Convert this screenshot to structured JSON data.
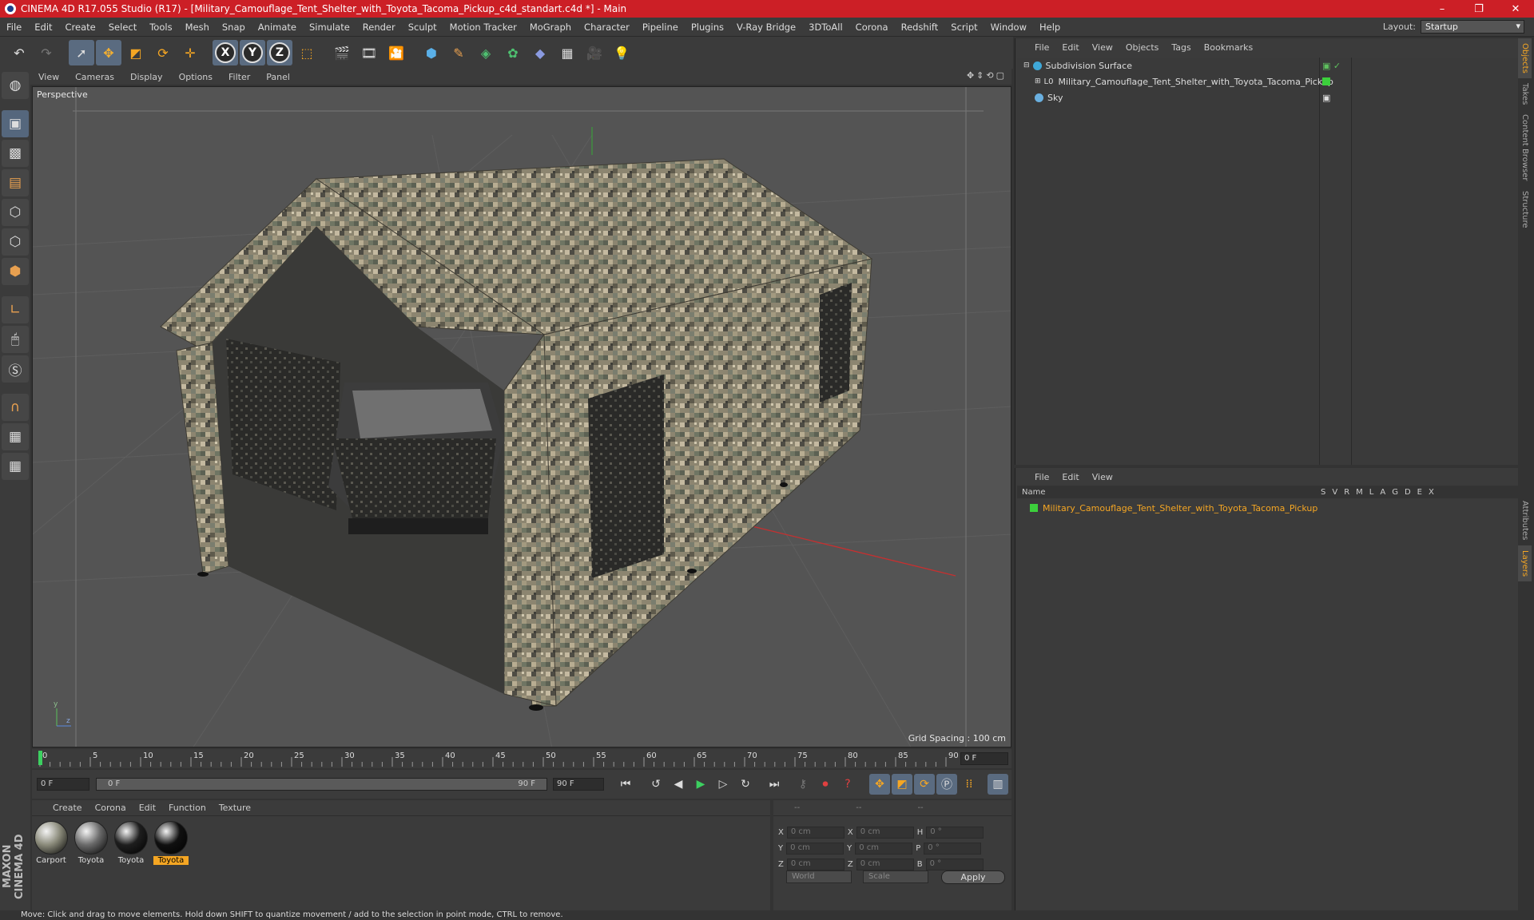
{
  "window": {
    "title": "CINEMA 4D R17.055 Studio (R17) - [Military_Camouflage_Tent_Shelter_with_Toyota_Tacoma_Pickup_c4d_standart.c4d *] - Main",
    "controls": [
      "–",
      "❐",
      "✕"
    ]
  },
  "menu": [
    "File",
    "Edit",
    "Create",
    "Select",
    "Tools",
    "Mesh",
    "Snap",
    "Animate",
    "Simulate",
    "Render",
    "Sculpt",
    "Motion Tracker",
    "MoGraph",
    "Character",
    "Pipeline",
    "Plugins",
    "V-Ray Bridge",
    "3DToAll",
    "Corona",
    "Redshift",
    "Script",
    "Window",
    "Help"
  ],
  "layout": {
    "label": "Layout:",
    "value": "Startup"
  },
  "toolbar": {
    "undo": "↶",
    "redo": "↷",
    "axis_x": "X",
    "axis_y": "Y",
    "axis_z": "Z"
  },
  "viewport": {
    "menu": [
      "View",
      "Cameras",
      "Display",
      "Options",
      "Filter",
      "Panel"
    ],
    "label": "Perspective",
    "grid_spacing": "Grid Spacing : 100 cm",
    "nav": "✥⇕⟲▢"
  },
  "timeline": {
    "ticks": [
      "0",
      "5",
      "10",
      "15",
      "20",
      "25",
      "30",
      "35",
      "40",
      "45",
      "50",
      "55",
      "60",
      "65",
      "70",
      "75",
      "80",
      "85",
      "90"
    ],
    "current": "0 F"
  },
  "playbar": {
    "start": "0 F",
    "slider_left": "0 F",
    "slider_right": "90 F",
    "end": "90 F"
  },
  "materials": {
    "menu": [
      "Create",
      "Corona",
      "Edit",
      "Function",
      "Texture"
    ],
    "items": [
      {
        "label": "Carport",
        "color": "#8a8a7a"
      },
      {
        "label": "Toyota",
        "color": "#6a6a6a"
      },
      {
        "label": "Toyota",
        "color": "#1e1e1e"
      },
      {
        "label": "Toyota",
        "color": "#101010",
        "selected": true
      }
    ]
  },
  "coords": {
    "headers": [
      "--",
      "--",
      "--"
    ],
    "rows": [
      {
        "a": "X",
        "av": "0 cm",
        "b": "X",
        "bv": "0 cm",
        "c": "H",
        "cv": "0 °"
      },
      {
        "a": "Y",
        "av": "0 cm",
        "b": "Y",
        "bv": "0 cm",
        "c": "P",
        "cv": "0 °"
      },
      {
        "a": "Z",
        "av": "0 cm",
        "b": "Z",
        "bv": "0 cm",
        "c": "B",
        "cv": "0 °"
      }
    ],
    "world": "World",
    "scale": "Scale",
    "apply": "Apply"
  },
  "objects": {
    "menu": [
      "File",
      "Edit",
      "View",
      "Objects",
      "Tags",
      "Bookmarks"
    ],
    "items": [
      {
        "name": "Subdivision Surface",
        "color": "#3fa8d8"
      },
      {
        "name": "Military_Camouflage_Tent_Shelter_with_Toyota_Tacoma_Pickup",
        "color": "#bbbbbb"
      },
      {
        "name": "Sky",
        "color": "#6ab0e0"
      }
    ]
  },
  "layers": {
    "menu": [
      "File",
      "Edit",
      "View"
    ],
    "header_name": "Name",
    "header_cols": [
      "S",
      "V",
      "R",
      "M",
      "L",
      "A",
      "G",
      "D",
      "E",
      "X"
    ],
    "item": "Military_Camouflage_Tent_Shelter_with_Toyota_Tacoma_Pickup",
    "item_color": "#f5a623"
  },
  "side_tabs": [
    "Objects",
    "Takes",
    "Content Browser",
    "Structure",
    "Attributes",
    "Layers"
  ],
  "branding": "MAXON CINEMA 4D",
  "status": "Move: Click and drag to move elements. Hold down SHIFT to quantize movement / add to the selection in point mode, CTRL to remove."
}
